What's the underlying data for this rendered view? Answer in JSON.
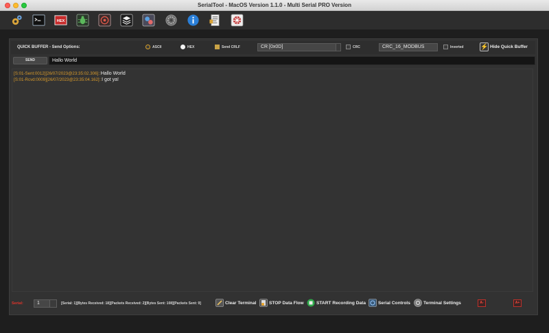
{
  "window": {
    "title": "SerialTool - MacOS Version 1.1.0 - Multi Serial PRO Version"
  },
  "toolbar": {
    "icons": [
      "settings-gears-icon",
      "terminal-icon",
      "hex-icon",
      "bug-icon",
      "crosshair-icon",
      "layers-icon",
      "link-scanner-icon",
      "gear-icon",
      "info-icon",
      "document-icon",
      "network-icon"
    ],
    "hex_label": "HEX"
  },
  "quick_buffer": {
    "title": "QUICK BUFFER - Send Options:",
    "ascii_label": "ASCII",
    "hex_label": "HEX",
    "crlf_label": "Send CRLF",
    "line_ending_value": "CR [0x0D]",
    "crc_label": "CRC",
    "crc_type_value": "CRC_16_MODBUS",
    "inverted_label": "Inverted",
    "hide_label": "Hide Quick Buffer",
    "send_label": "SEND",
    "send_input_value": "Hallo World"
  },
  "terminal": {
    "lines": [
      {
        "tag": "[S:01-Sent:0012][26/07/2023@23:35:02.306]::",
        "message": "Hallo World"
      },
      {
        "tag": "[S:01-Rcvd:0009][26/07/2023@23:35:04.162]::",
        "message": "I got ya!"
      }
    ]
  },
  "status_bar": {
    "serial_label": "Serial:",
    "serial_value": "1",
    "stats": "[Serial: 1][Bytes Received: 18][Packets Received: 2][Bytes Sent: 108][Packets Sent: 9]",
    "clear_label": "Clear Terminal",
    "stop_label": "STOP Data Flow",
    "record_label": "START Recording Data",
    "controls_label": "Serial Controls",
    "settings_label": "Terminal Settings",
    "font_down_label": "A-",
    "font_up_label": "A+"
  },
  "colors": {
    "accent_orange": "#d89a2a",
    "serial_red": "#e0342a",
    "background": "#333333"
  }
}
